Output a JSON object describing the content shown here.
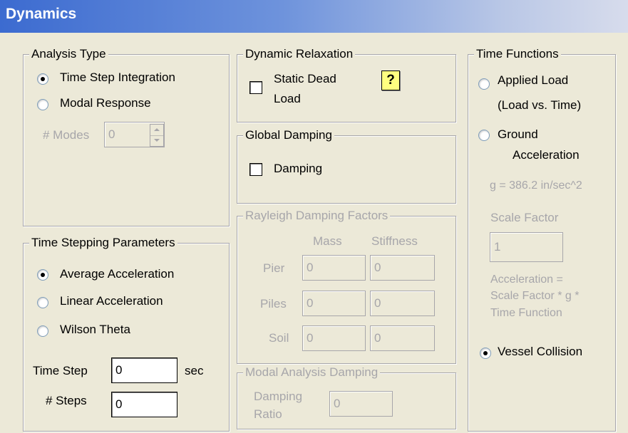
{
  "window": {
    "title": "Dynamics"
  },
  "analysis_type": {
    "legend": "Analysis Type",
    "options": [
      "Time Step Integration",
      "Modal Response"
    ],
    "selected": "Time Step Integration",
    "modes_label": "# Modes",
    "modes_value": "0"
  },
  "time_stepping": {
    "legend": "Time Stepping Parameters",
    "options": [
      "Average Acceleration",
      "Linear Acceleration",
      "Wilson Theta"
    ],
    "selected": "Average Acceleration",
    "time_step_label": "Time Step",
    "time_step_value": "0",
    "time_step_unit": "sec",
    "steps_label": "# Steps",
    "steps_value": "0"
  },
  "dynamic_relaxation": {
    "legend": "Dynamic Relaxation",
    "static_dead_load_line1": "Static Dead",
    "static_dead_load_line2": "Load",
    "help": "?"
  },
  "global_damping": {
    "legend": "Global Damping",
    "damping_label": "Damping"
  },
  "rayleigh": {
    "legend": "Rayleigh Damping Factors",
    "col_mass": "Mass",
    "col_stiffness": "Stiffness",
    "rows": [
      {
        "label": "Pier",
        "mass": "0",
        "stiffness": "0"
      },
      {
        "label": "Piles",
        "mass": "0",
        "stiffness": "0"
      },
      {
        "label": "Soil",
        "mass": "0",
        "stiffness": "0"
      }
    ]
  },
  "modal_damping": {
    "legend": "Modal Analysis Damping",
    "ratio_line1": "Damping",
    "ratio_line2": "Ratio",
    "ratio_value": "0"
  },
  "time_functions": {
    "legend": "Time Functions",
    "applied_load_line1": "Applied Load",
    "applied_load_line2": "(Load vs. Time)",
    "ground_line1": "Ground",
    "ground_line2": "Acceleration",
    "g_note": "g = 386.2 in/sec^2",
    "scale_factor_label": "Scale Factor",
    "scale_factor_value": "1",
    "formula_line1": "Acceleration =",
    "formula_line2": "Scale Factor * g *",
    "formula_line3": "Time Function",
    "vessel_collision": "Vessel Collision",
    "selected": "Vessel Collision"
  }
}
